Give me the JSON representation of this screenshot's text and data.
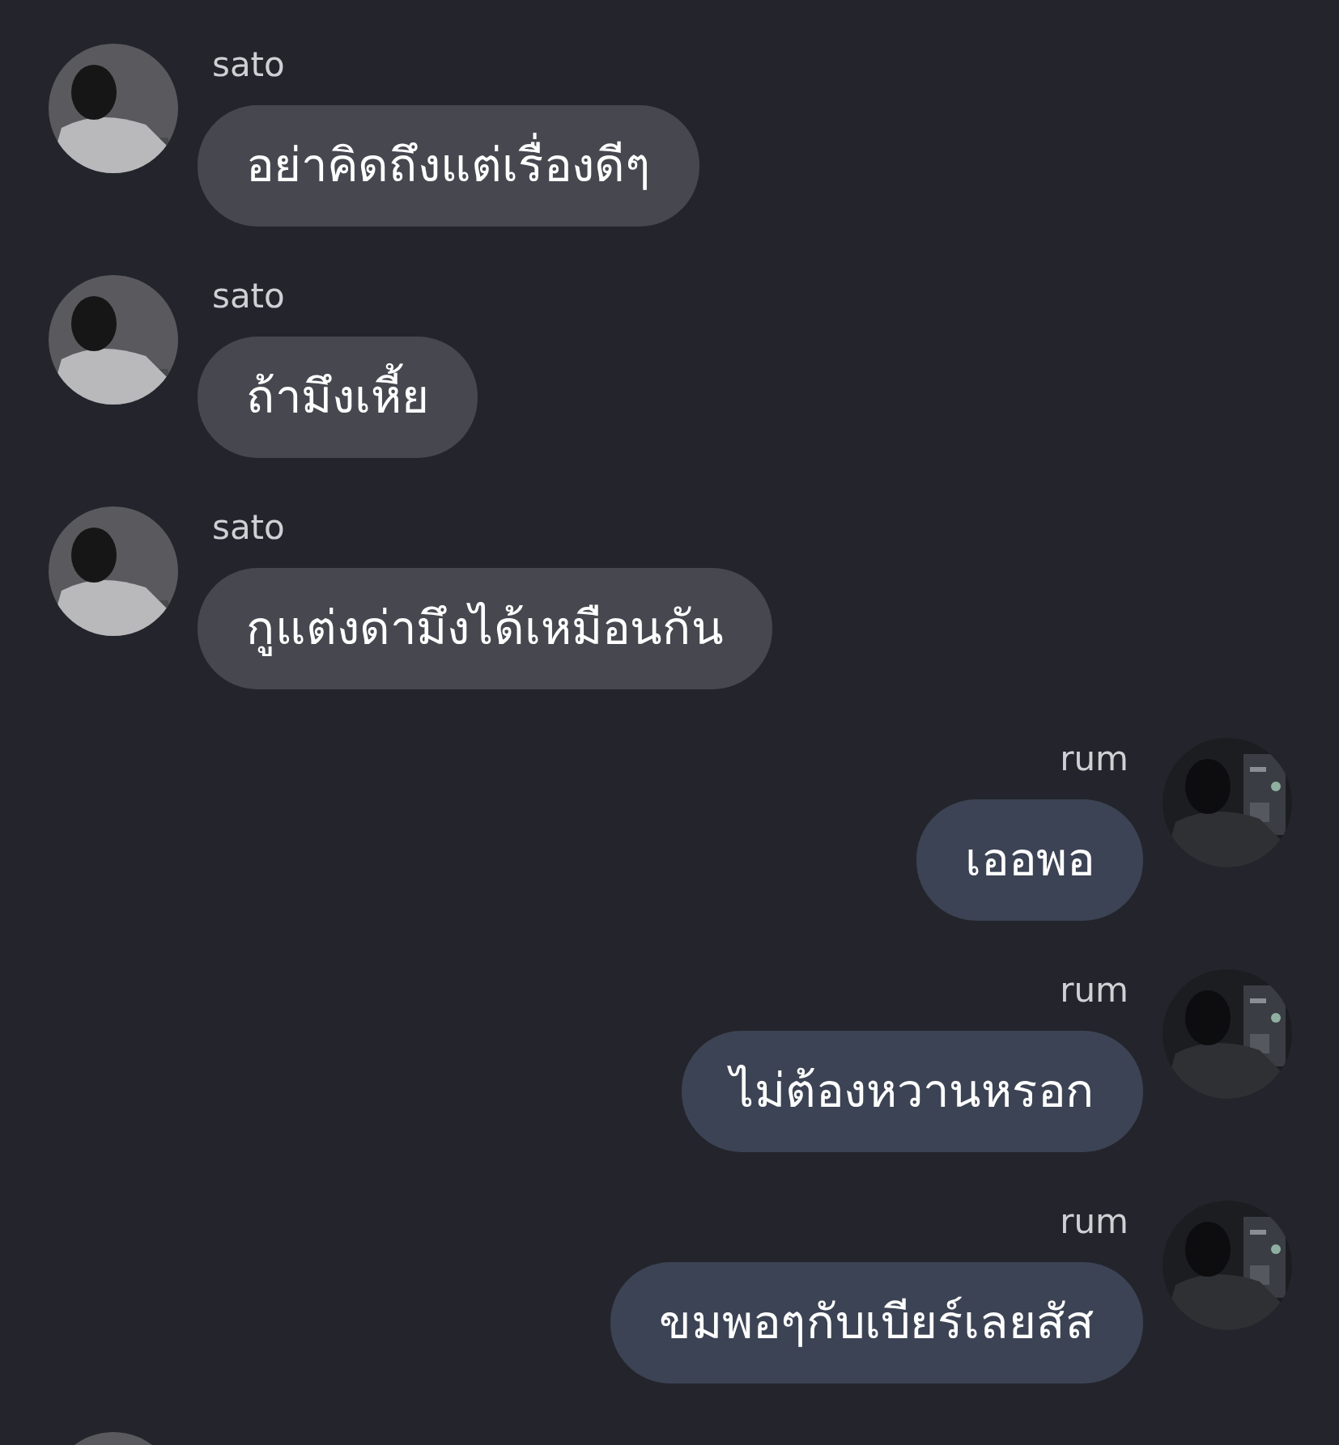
{
  "messages": [
    {
      "outgoing": false,
      "sender": "sato",
      "text": "อย่าคิดถึงแต่เรื่องดีๆ"
    },
    {
      "outgoing": false,
      "sender": "sato",
      "text": "ถ้ามึงเหี้ย"
    },
    {
      "outgoing": false,
      "sender": "sato",
      "text": "กูแต่งด่ามึงได้เหมือนกัน"
    },
    {
      "outgoing": true,
      "sender": "rum",
      "text": "เออพอ"
    },
    {
      "outgoing": true,
      "sender": "rum",
      "text": "ไม่ต้องหวานหรอก"
    },
    {
      "outgoing": true,
      "sender": "rum",
      "text": "ขมพอๆกับเบียร์เลยสัส"
    },
    {
      "outgoing": false
    }
  ]
}
